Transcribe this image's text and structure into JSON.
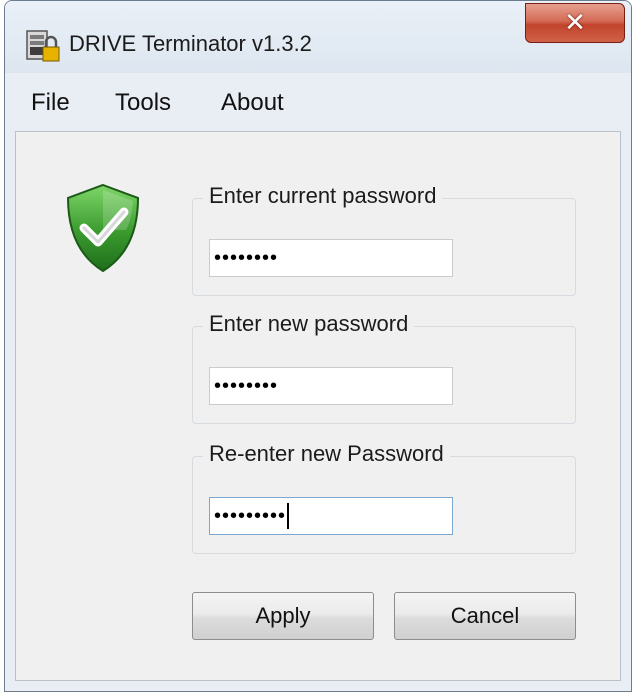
{
  "window": {
    "title": "DRIVE Terminator v1.3.2"
  },
  "icons": {
    "app": "drive-lock-icon",
    "close": "close-icon",
    "status": "shield-check-icon"
  },
  "menu": {
    "items": [
      "File",
      "Tools",
      "About"
    ]
  },
  "fields": {
    "current": {
      "label": "Enter current password",
      "value": "••••••••"
    },
    "new": {
      "label": "Enter new password",
      "value": "••••••••"
    },
    "confirm": {
      "label": "Re-enter new Password",
      "value": "•••••••••"
    }
  },
  "buttons": {
    "apply": "Apply",
    "cancel": "Cancel"
  },
  "colors": {
    "close_button": "#c8442c",
    "shield": "#3a9a2e",
    "window_bg": "#e9eef4"
  }
}
